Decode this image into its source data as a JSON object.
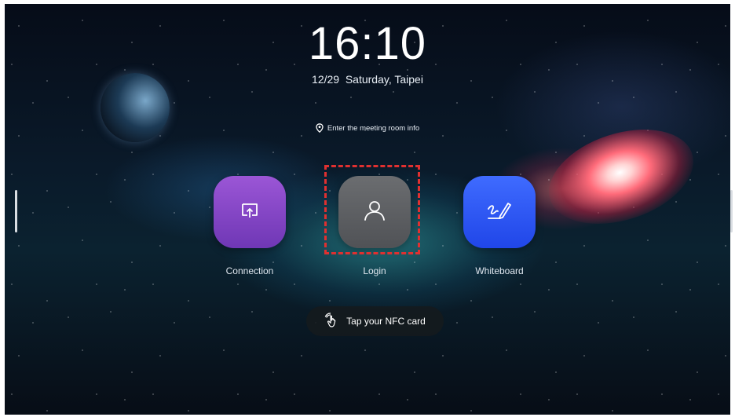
{
  "header": {
    "time": "16:10",
    "date": "12/29  Saturday, Taipei"
  },
  "room_info": {
    "label": "Enter the meeting room info",
    "icon": "location-pin-icon"
  },
  "apps": [
    {
      "label": "Connection",
      "icon": "screen-share-icon",
      "color": "#8a4bd0"
    },
    {
      "label": "Login",
      "icon": "user-icon",
      "color": "#5f6164"
    },
    {
      "label": "Whiteboard",
      "icon": "pen-scribble-icon",
      "color": "#2f57f5"
    }
  ],
  "nfc": {
    "label": "Tap your NFC card",
    "icon": "nfc-tap-icon"
  },
  "highlight": {
    "color": "#e03030"
  }
}
